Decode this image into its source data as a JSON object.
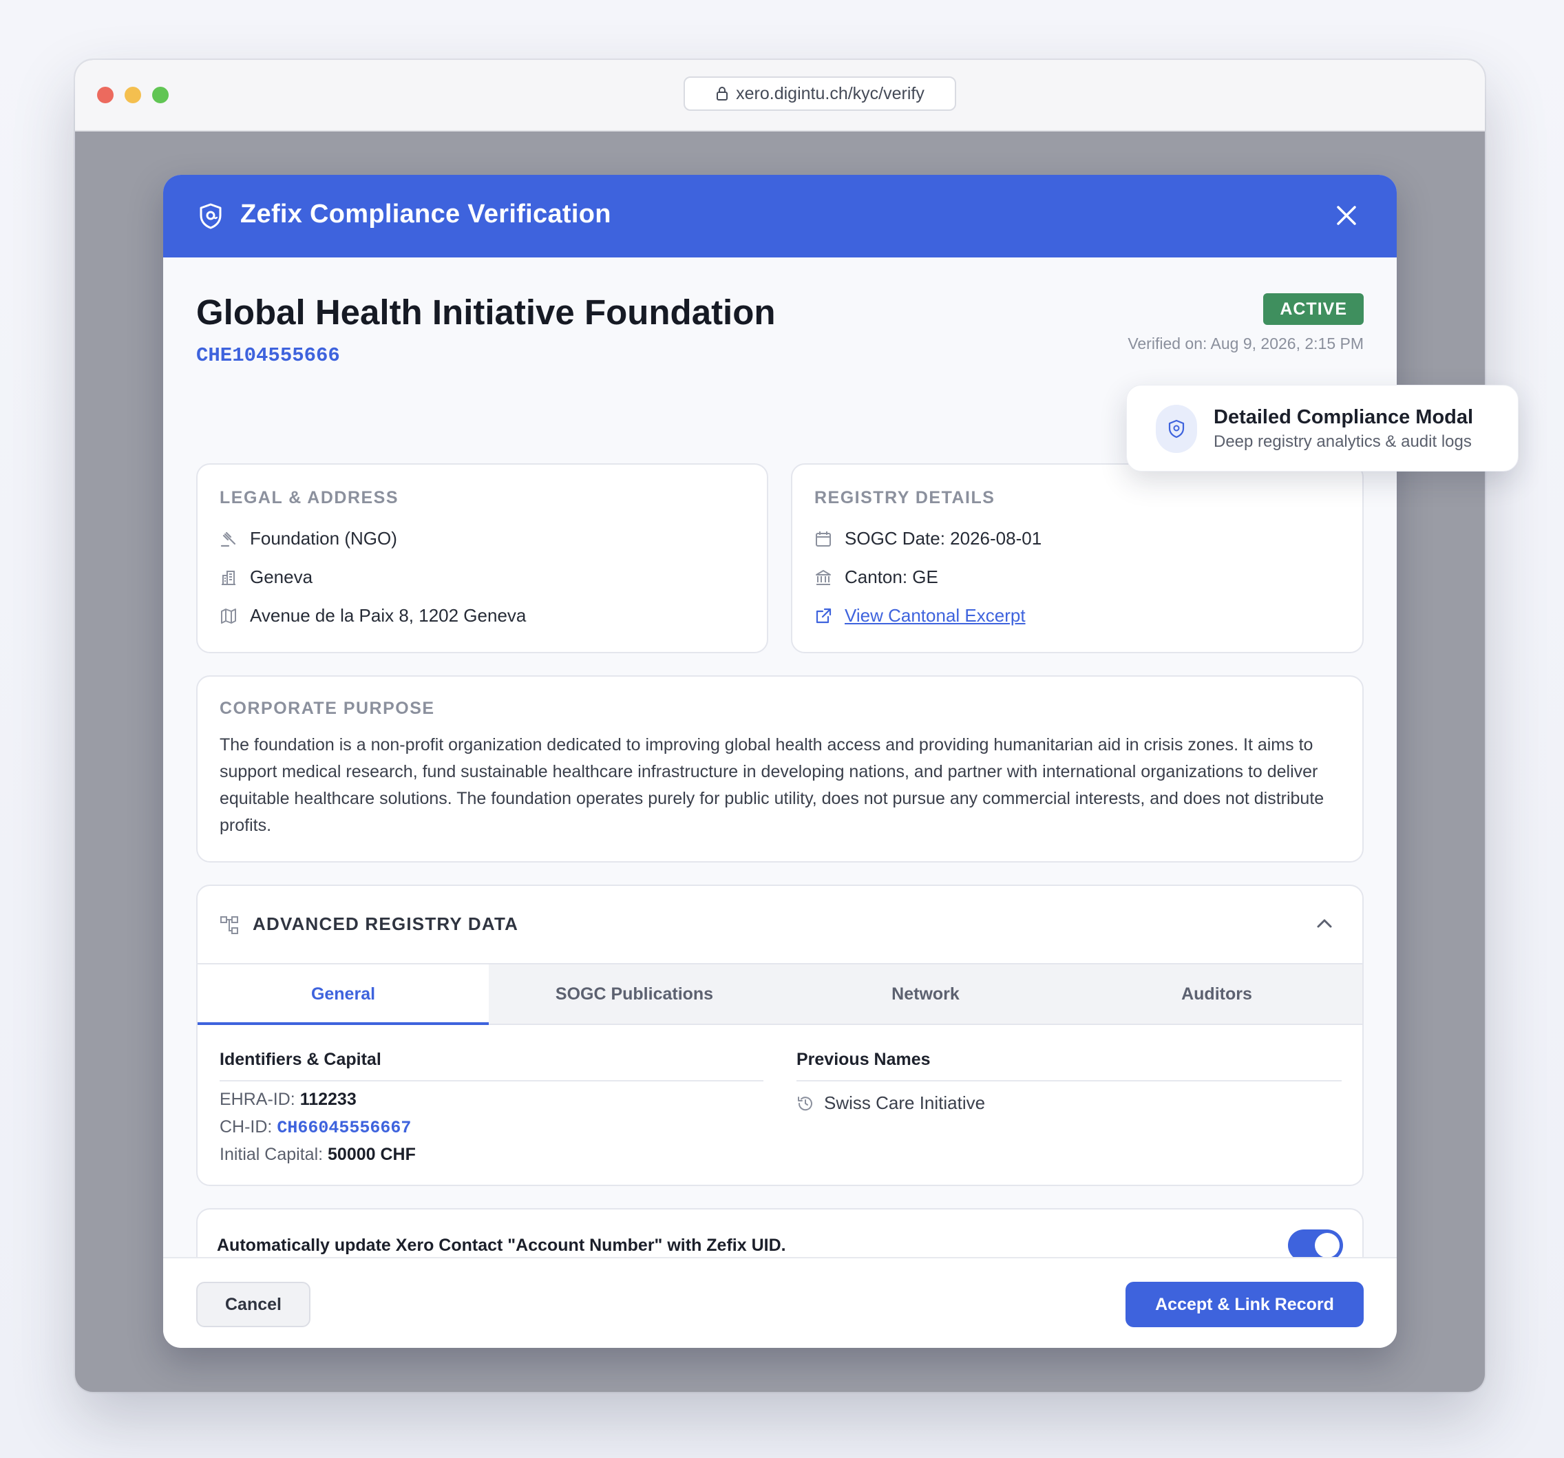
{
  "browser": {
    "url": "xero.digintu.ch/kyc/verify"
  },
  "modal": {
    "title": "Zefix Compliance Verification",
    "entity_name": "Global Health Initiative Foundation",
    "uid": "CHE104555666",
    "status": "ACTIVE",
    "verified": "Verified on: Aug 9, 2026, 2:15 PM"
  },
  "legal": {
    "title": "LEGAL & ADDRESS",
    "legal_form": "Foundation (NGO)",
    "city": "Geneva",
    "address": "Avenue de la Paix 8, 1202 Geneva"
  },
  "registry": {
    "title": "REGISTRY DETAILS",
    "sogc_date": "SOGC Date: 2026-08-01",
    "canton": "Canton: GE",
    "excerpt_link": "View Cantonal Excerpt"
  },
  "purpose": {
    "title": "CORPORATE PURPOSE",
    "text": "The foundation is a non-profit organization dedicated to improving global health access and providing humanitarian aid in crisis zones. It aims to support medical research, fund sustainable healthcare infrastructure in developing nations, and partner with international organizations to deliver equitable healthcare solutions. The foundation operates purely for public utility, does not pursue any commercial interests, and does not distribute profits."
  },
  "advanced": {
    "title": "ADVANCED REGISTRY DATA",
    "tabs": [
      "General",
      "SOGC Publications",
      "Network",
      "Auditors"
    ],
    "active_tab": "General",
    "identifiers": {
      "title": "Identifiers & Capital",
      "ehra_label": "EHRA-ID:",
      "ehra_value": "112233",
      "chid_label": "CH-ID:",
      "chid_value": "CH66045556667",
      "capital_label": "Initial Capital:",
      "capital_value": "50000 CHF"
    },
    "previous_names": {
      "title": "Previous Names",
      "items": [
        "Swiss Care Initiative"
      ]
    }
  },
  "toggle": {
    "label": "Automatically update Xero Contact \"Account Number\" with Zefix UID.",
    "enabled": true
  },
  "footer": {
    "cancel": "Cancel",
    "accept": "Accept & Link Record"
  },
  "tooltip": {
    "title": "Detailed Compliance Modal",
    "subtitle": "Deep registry analytics & audit logs"
  },
  "colors": {
    "accent": "#3e63dd",
    "status_active": "#3f8f5e"
  }
}
